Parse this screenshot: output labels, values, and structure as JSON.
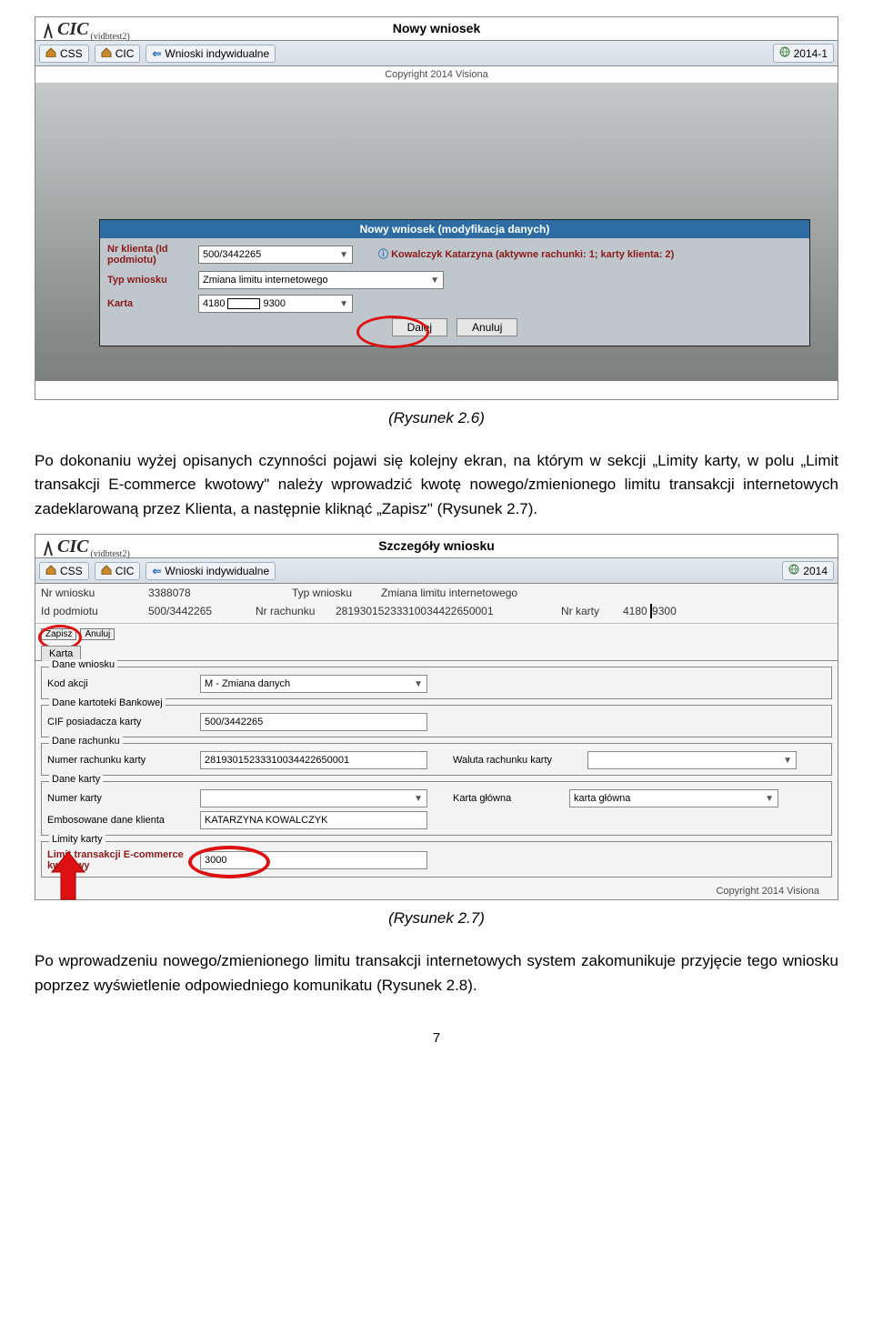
{
  "shot1": {
    "title": "Nowy wniosek",
    "logo_sub": "(vidbtest2)",
    "tabs": {
      "css": "CSS",
      "cic": "CIC",
      "wnioski": "Wnioski indywidualne",
      "year": "2014-1"
    },
    "copyright": "Copyright 2014 Visiona",
    "modal_title": "Nowy wniosek (modyfikacja danych)",
    "lbl_nr_klienta": "Nr klienta (Id podmiotu)",
    "val_nr_klienta": "500/3442265",
    "client_line": "Kowalczyk Katarzyna (aktywne rachunki: 1; karty klienta: 2)",
    "lbl_typ": "Typ wniosku",
    "val_typ": "Zmiana limitu internetowego",
    "lbl_karta": "Karta",
    "val_karta_a": "4180",
    "val_karta_b": "9300",
    "btn_dalej": "Dalej",
    "btn_anuluj": "Anuluj"
  },
  "caption26": "(Rysunek 2.6)",
  "para1": "Po dokonaniu wyżej opisanych czynności pojawi się kolejny ekran, na którym w sekcji „Limity karty, w polu „Limit transakcji E-commerce kwotowy\" należy wprowadzić kwotę nowego/zmienionego limitu transakcji internetowych zadeklarowaną przez Klienta, a następnie kliknąć „Zapisz\" (Rysunek 2.7).",
  "shot2": {
    "title": "Szczegóły wniosku",
    "logo_sub": "(vidbtest2)",
    "tabs": {
      "css": "CSS",
      "cic": "CIC",
      "wnioski": "Wnioski indywidualne",
      "year": "2014"
    },
    "r1": {
      "nr_w_lbl": "Nr wniosku",
      "nr_w_val": "3388078",
      "typ_lbl": "Typ wniosku",
      "typ_val": "Zmiana limitu internetowego"
    },
    "r2": {
      "idp_lbl": "Id podmiotu",
      "idp_val": "500/3442265",
      "nrr_lbl": "Nr rachunku",
      "nrr_val": "28193015233310034422650001",
      "nrk_lbl": "Nr karty",
      "nrk_a": "4180",
      "nrk_b": "9300"
    },
    "zapisz": "Zapisz",
    "anuluj": "Anuluj",
    "karta_tab": "Karta",
    "fs_dane_wn": "Dane wniosku",
    "kod_akcji_lbl": "Kod akcji",
    "kod_akcji_val": "M - Zmiana danych",
    "fs_bank": "Dane kartoteki Bankowej",
    "cif_lbl": "CIF posiadacza karty",
    "cif_val": "500/3442265",
    "fs_rach": "Dane rachunku",
    "num_rach_lbl": "Numer rachunku karty",
    "num_rach_val": "28193015233310034422650001",
    "waluta_lbl": "Waluta rachunku karty",
    "fs_karty": "Dane karty",
    "num_karty_lbl": "Numer karty",
    "emboso_lbl": "Embosowane dane klienta",
    "emboso_val": "KATARZYNA KOWALCZYK",
    "karta_gl_lbl": "Karta główna",
    "karta_gl_val": "karta główna",
    "fs_limity": "Limity karty",
    "limit_lbl": "Limit transakcji E-commerce kwotowy",
    "limit_val": "3000",
    "copyright": "Copyright 2014 Visiona"
  },
  "caption27": "(Rysunek 2.7)",
  "para2": "Po wprowadzeniu nowego/zmienionego limitu transakcji internetowych system zakomunikuje przyjęcie tego wniosku poprzez wyświetlenie odpowiedniego komunikatu (Rysunek 2.8).",
  "page_num": "7"
}
